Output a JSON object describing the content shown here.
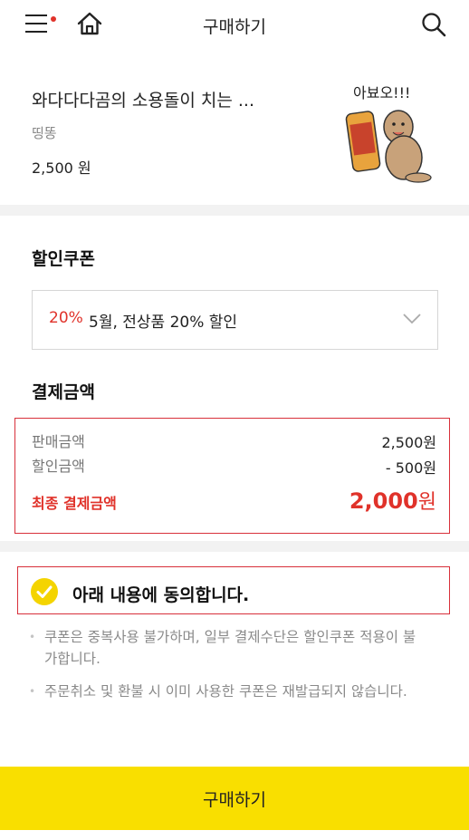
{
  "header": {
    "title": "구매하기",
    "menu_icon": "hamburger-menu-icon",
    "home_icon": "home-icon",
    "search_icon": "search-icon",
    "notification_dot_color": "#e0322a"
  },
  "product": {
    "name": "와다다다곰의 소용돌이 치는 ...",
    "seller": "띵똥",
    "price": "2,500 원",
    "sticker_caption": "아뵤오!!!"
  },
  "coupon": {
    "title": "할인쿠폰",
    "selected_percent": "20%",
    "selected_label": "5월, 전상품 20% 할인"
  },
  "payment": {
    "title": "결제금액",
    "rows": [
      {
        "label": "판매금액",
        "value": "2,500원"
      },
      {
        "label": "할인금액",
        "value": "- 500원"
      }
    ],
    "final_label": "최종 결제금액",
    "final_amount": "2,000",
    "final_unit": "원"
  },
  "agreement": {
    "label": "아래 내용에 동의합니다.",
    "checked": true,
    "notes": [
      "쿠폰은 중복사용 불가하며, 일부 결제수단은 할인쿠폰 적용이 불가합니다.",
      "주문취소 및 환불 시 이미 사용한 쿠폰은 재발급되지 않습니다."
    ]
  },
  "buy_button": {
    "label": "구매하기"
  },
  "colors": {
    "accent_red": "#e0322a",
    "highlight_red": "#d8303a",
    "buy_yellow": "#f9df00",
    "check_yellow": "#f4d400"
  }
}
